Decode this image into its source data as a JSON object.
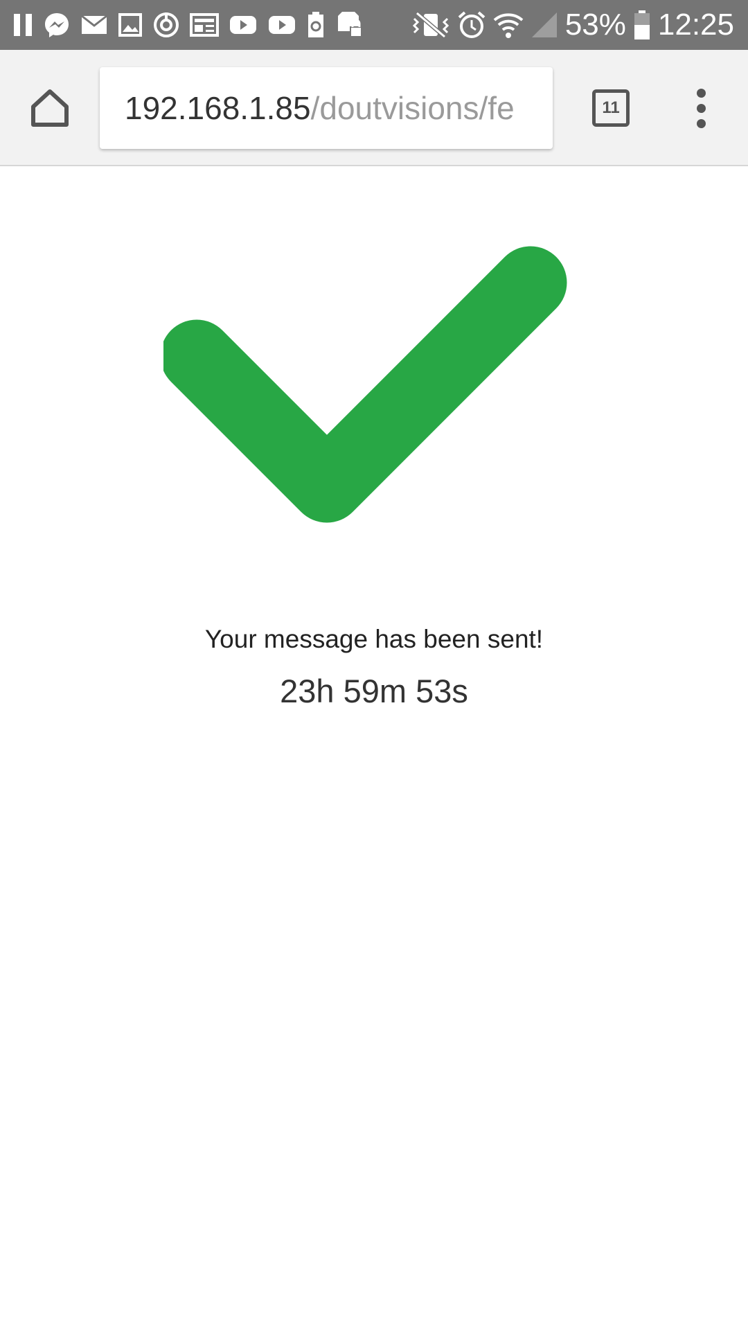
{
  "status_bar": {
    "left_icons": [
      "pause-icon",
      "messenger-icon",
      "mail-icon",
      "image-icon",
      "sync-icon",
      "news-icon",
      "youtube-icon",
      "youtube-icon",
      "battery-saver-icon",
      "sd-card-icon"
    ],
    "right_icons": [
      "vibrate-icon",
      "alarm-icon",
      "wifi-icon",
      "cell-signal-icon",
      "battery-icon"
    ],
    "battery_percent": "53%",
    "time": "12:25",
    "background_color": "#757575"
  },
  "browser": {
    "url_host": "192.168.1.85",
    "url_path": "/doutvisions/fe",
    "tab_count": "11",
    "home_icon": "home-icon",
    "menu_icon": "more-vert-icon"
  },
  "page": {
    "icon": "checkmark-icon",
    "icon_color": "#28a745",
    "message": "Your message has been sent!",
    "countdown": "23h 59m 53s"
  }
}
